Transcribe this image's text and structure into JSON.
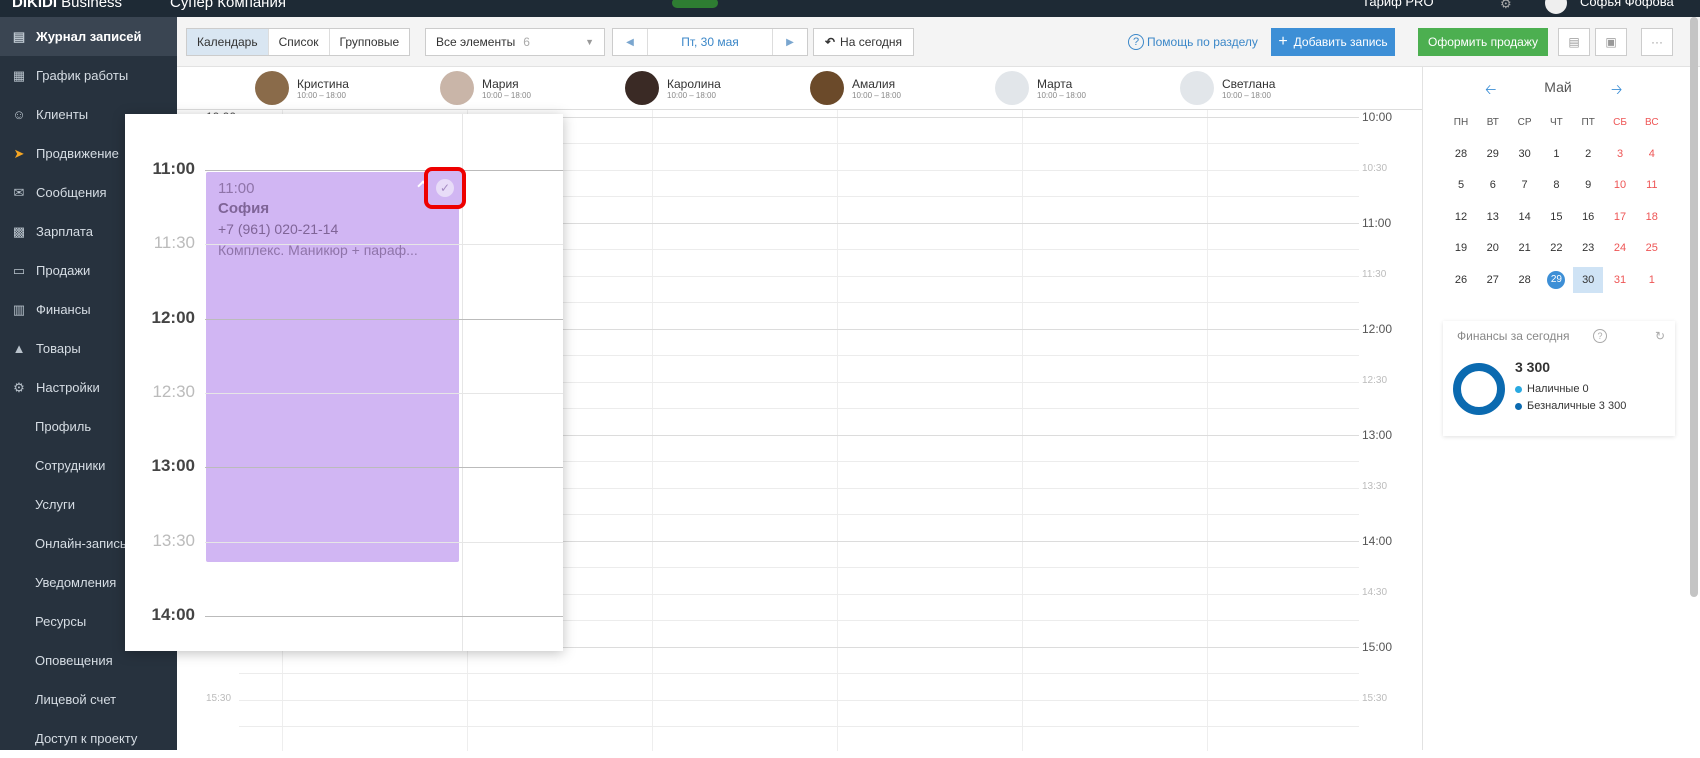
{
  "topbar": {
    "brand_bold": "DIKIDI",
    "brand_rest": " Business",
    "company": "Супер Компания",
    "tariff": "Тариф PRO",
    "user": "Софья Фофова"
  },
  "sidebar": {
    "items": [
      {
        "label": "Журнал записей",
        "icon": "journal-icon"
      },
      {
        "label": "График работы",
        "icon": "calendar-icon"
      },
      {
        "label": "Клиенты",
        "icon": "clients-icon"
      },
      {
        "label": "Продвижение",
        "icon": "rocket-icon"
      },
      {
        "label": "Сообщения",
        "icon": "messages-icon"
      },
      {
        "label": "Зарплата",
        "icon": "salary-icon"
      },
      {
        "label": "Продажи",
        "icon": "sales-icon"
      },
      {
        "label": "Финансы",
        "icon": "finance-icon"
      },
      {
        "label": "Товары",
        "icon": "goods-icon"
      },
      {
        "label": "Настройки",
        "icon": "gear-icon"
      }
    ],
    "sub_items": [
      "Профиль",
      "Сотрудники",
      "Услуги",
      "Онлайн-запись",
      "Уведомления",
      "Ресурсы",
      "Оповещения",
      "Лицевой счет",
      "Доступ к проекту"
    ]
  },
  "toolbar": {
    "views": [
      "Календарь",
      "Список",
      "Групповые"
    ],
    "elements_label": "Все элементы",
    "elements_count": "6",
    "date": "Пт, 30 мая",
    "today": "На сегодня",
    "help": "Помощь по разделу",
    "add": "Добавить запись",
    "sale": "Оформить продажу"
  },
  "staff": [
    {
      "name": "Кристина",
      "hours": "10:00 – 18:00"
    },
    {
      "name": "Мария",
      "hours": "10:00 – 18:00"
    },
    {
      "name": "Каролина",
      "hours": "10:00 – 18:00"
    },
    {
      "name": "Амалия",
      "hours": "10:00 – 18:00"
    },
    {
      "name": "Марта",
      "hours": "10:00 – 18:00"
    },
    {
      "name": "Светлана",
      "hours": "10:00 – 18:00"
    }
  ],
  "times": [
    "10:00",
    "10:30",
    "11:00",
    "11:30",
    "12:00",
    "12:30",
    "13:00",
    "13:30",
    "14:00",
    "14:30",
    "15:00",
    "15:30"
  ],
  "calendar": {
    "month": "Май",
    "dow": [
      "ПН",
      "ВТ",
      "СР",
      "ЧТ",
      "ПТ",
      "СБ",
      "ВС"
    ],
    "weeks": [
      [
        "28",
        "29",
        "30",
        "1",
        "2",
        "3",
        "4"
      ],
      [
        "5",
        "6",
        "7",
        "8",
        "9",
        "10",
        "11"
      ],
      [
        "12",
        "13",
        "14",
        "15",
        "16",
        "17",
        "18"
      ],
      [
        "19",
        "20",
        "21",
        "22",
        "23",
        "24",
        "25"
      ],
      [
        "26",
        "27",
        "28",
        "29",
        "30",
        "31",
        "1"
      ]
    ]
  },
  "finance": {
    "title": "Финансы за сегодня",
    "total": "3 300",
    "cash_label": "Наличные",
    "cash_value": "0",
    "card_label": "Безналичные",
    "card_value": "3 300",
    "cash_color": "#29a9e1",
    "card_color": "#0b6ab0"
  },
  "popup": {
    "times": [
      "11:00",
      "11:30",
      "12:00",
      "12:30",
      "13:00",
      "13:30",
      "14:00"
    ],
    "appointment": {
      "time": "11:00",
      "client": "София",
      "phone": "+7 (961) 020-21-14",
      "service": "Комплекс. Маникюр + параф..."
    }
  }
}
